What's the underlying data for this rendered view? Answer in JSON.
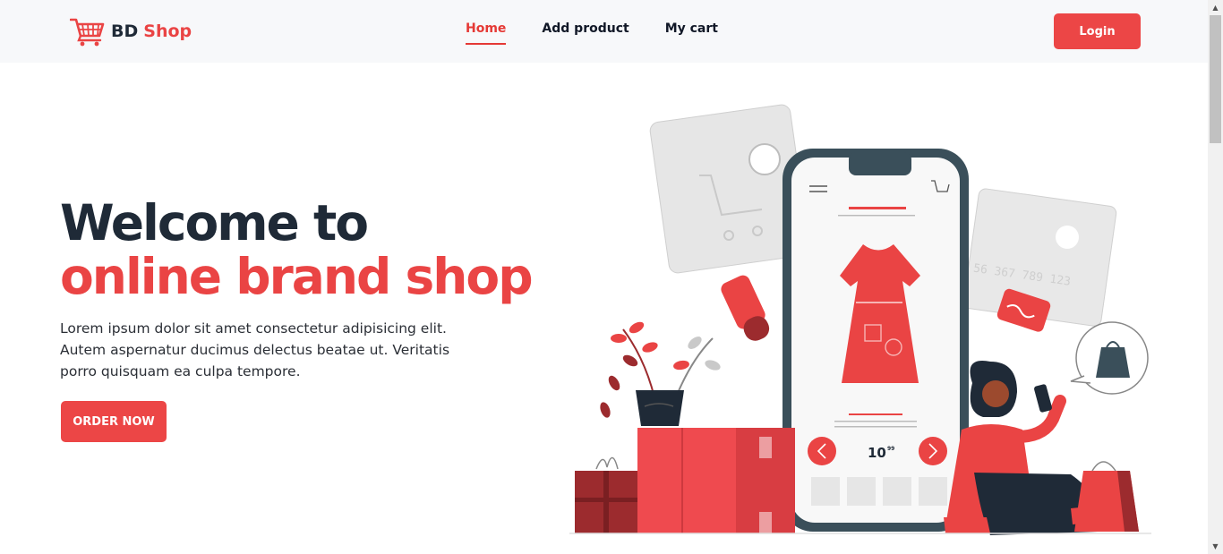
{
  "navbar": {
    "brand_bd": "BD",
    "brand_shop": "Shop",
    "brand_icon": "shopping-cart-icon",
    "links": [
      {
        "label": "Home",
        "active": true
      },
      {
        "label": "Add product",
        "active": false
      },
      {
        "label": "My cart",
        "active": false
      }
    ],
    "login_label": "Login"
  },
  "hero": {
    "title_line1": "Welcome to",
    "title_line2": "online brand shop",
    "description": "Lorem ipsum dolor sit amet consectetur adipisicing elit. Autem aspernatur ducimus delectus beatae ut. Veritatis porro quisquam ea culpa tempore.",
    "order_label": "ORDER NOW"
  },
  "illustration": {
    "price_main": "10",
    "price_cents": "99",
    "card_number": "56 367 789 123"
  },
  "colors": {
    "accent": "#ea4444",
    "dark": "#1f2a37",
    "navbar_bg": "#f7f8fa",
    "phone_frame": "#3a4f5a"
  }
}
